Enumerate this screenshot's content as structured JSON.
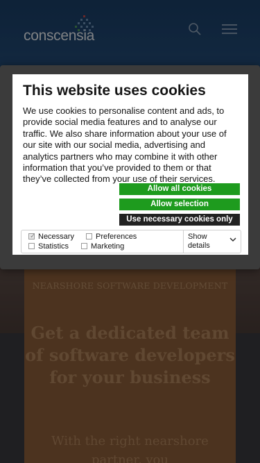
{
  "header": {
    "logo_text": "conscensia",
    "search_icon": "search-icon",
    "menu_icon": "hamburger-menu-icon"
  },
  "hero_card": {
    "kicker": "NEARSHORE SOFTWARE DEVELOPMENT",
    "heading": "Get a dedicated team of software developers for your business",
    "subheading": "With the right nearshore partner, you"
  },
  "cookie_dialog": {
    "title": "This website uses cookies",
    "body": "We use cookies to personalise content and ads, to provide social media features and to analyse our traffic. We also share information about your use of our site with our social media, advertising and analytics partners who may combine it with other information that you’ve provided to them or that they’ve collected from your use of their services.",
    "buttons": {
      "allow_all": "Allow all cookies",
      "allow_selection": "Allow selection",
      "use_necessary": "Use necessary cookies only"
    },
    "preferences": {
      "necessary": "Necessary",
      "preferences": "Preferences",
      "statistics": "Statistics",
      "marketing": "Marketing",
      "show_details": "Show details"
    },
    "necessary_checked": true
  },
  "colors": {
    "allow_green": "#1e9b1e",
    "dark_button": "#222222",
    "card_orange": "#8a5d3a"
  }
}
